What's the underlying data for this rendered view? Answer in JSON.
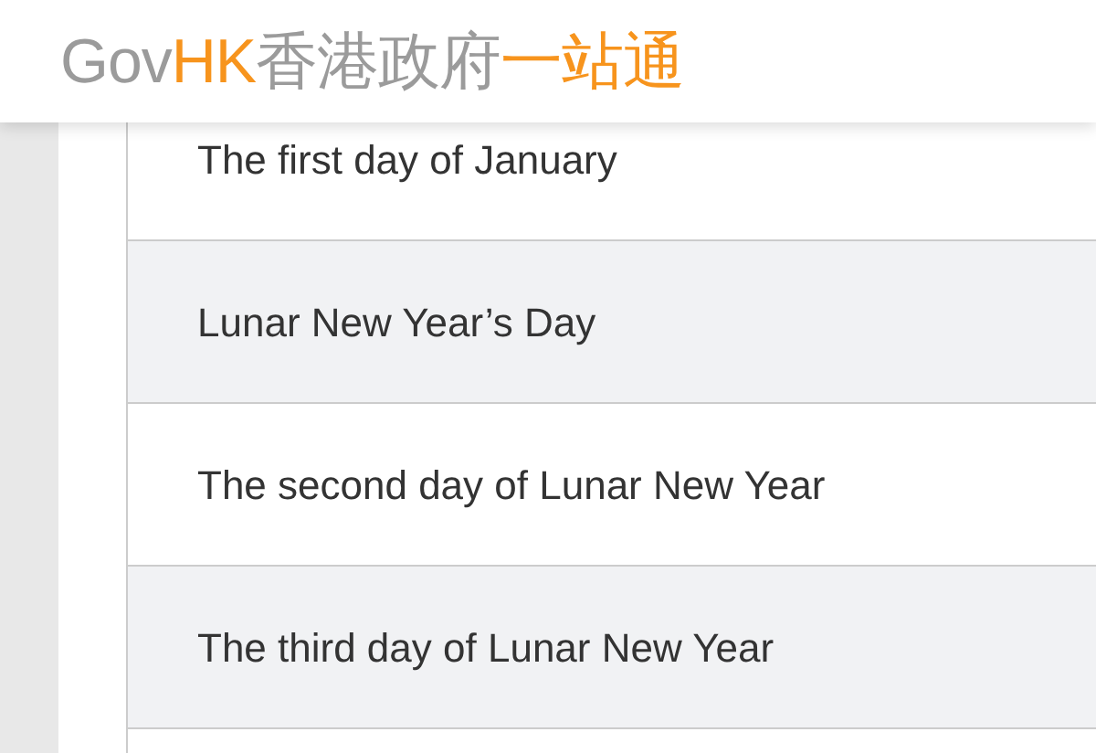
{
  "header": {
    "logo": [
      {
        "text": "Gov",
        "color": "#9b9b9b"
      },
      {
        "text": "HK",
        "color": "#f7941d"
      },
      {
        "text": "香港政府",
        "color": "#9b9b9b"
      },
      {
        "text": "一站通",
        "color": "#f7941d"
      }
    ]
  },
  "holidays": [
    {
      "name": "The first day of January"
    },
    {
      "name": "Lunar New Year’s Day"
    },
    {
      "name": "The second day of Lunar New Year"
    },
    {
      "name": "The third day of Lunar New Year"
    }
  ]
}
